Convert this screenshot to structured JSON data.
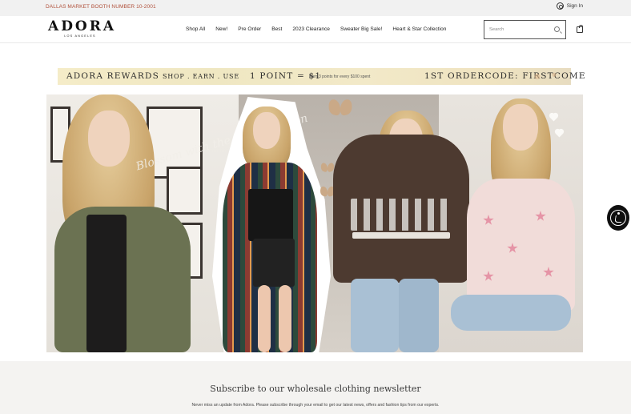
{
  "topbar": {
    "announcement": "DALLAS MARKET BOOTH NUMBER 10-2001",
    "signin_label": "Sign In",
    "signin_icon": "user-circle-icon"
  },
  "header": {
    "logo_text": "ADORA",
    "logo_sub": "LOS ANGELES",
    "nav": [
      "Shop All",
      "New!",
      "Pre Order",
      "Best",
      "2023 Clearance",
      "Sweater Big Sale!",
      "Heart & Star Collection"
    ],
    "search_placeholder": "Search",
    "search_icon": "search-icon",
    "cart_icon": "shopping-bag-icon"
  },
  "rewards_banner": {
    "title": "ADORA REWARDS",
    "tagline": "SHOP . EARN . USE",
    "point_rate": "1 POINT = $1",
    "earn_text": "Earn 3 points for every $100 spent",
    "order_code": "1ST ORDERCODE:  FIRSTCOME"
  },
  "hero": {
    "script_text": "Blossom with the latest fashion",
    "colors": {
      "jacket": "#6b7252",
      "plaid": "#8c3b32",
      "sweater_brown": "#4d3a30",
      "sweater_pink": "#f1dcd9",
      "star_pink": "#e594a6"
    }
  },
  "accessibility": {
    "icon": "accessibility-icon"
  },
  "newsletter": {
    "title": "Subscribe to our wholesale clothing newsletter",
    "description": "Never miss an update from Adora. Please subscribe through your email to get our latest news, offers and fashion tips from our experts."
  }
}
